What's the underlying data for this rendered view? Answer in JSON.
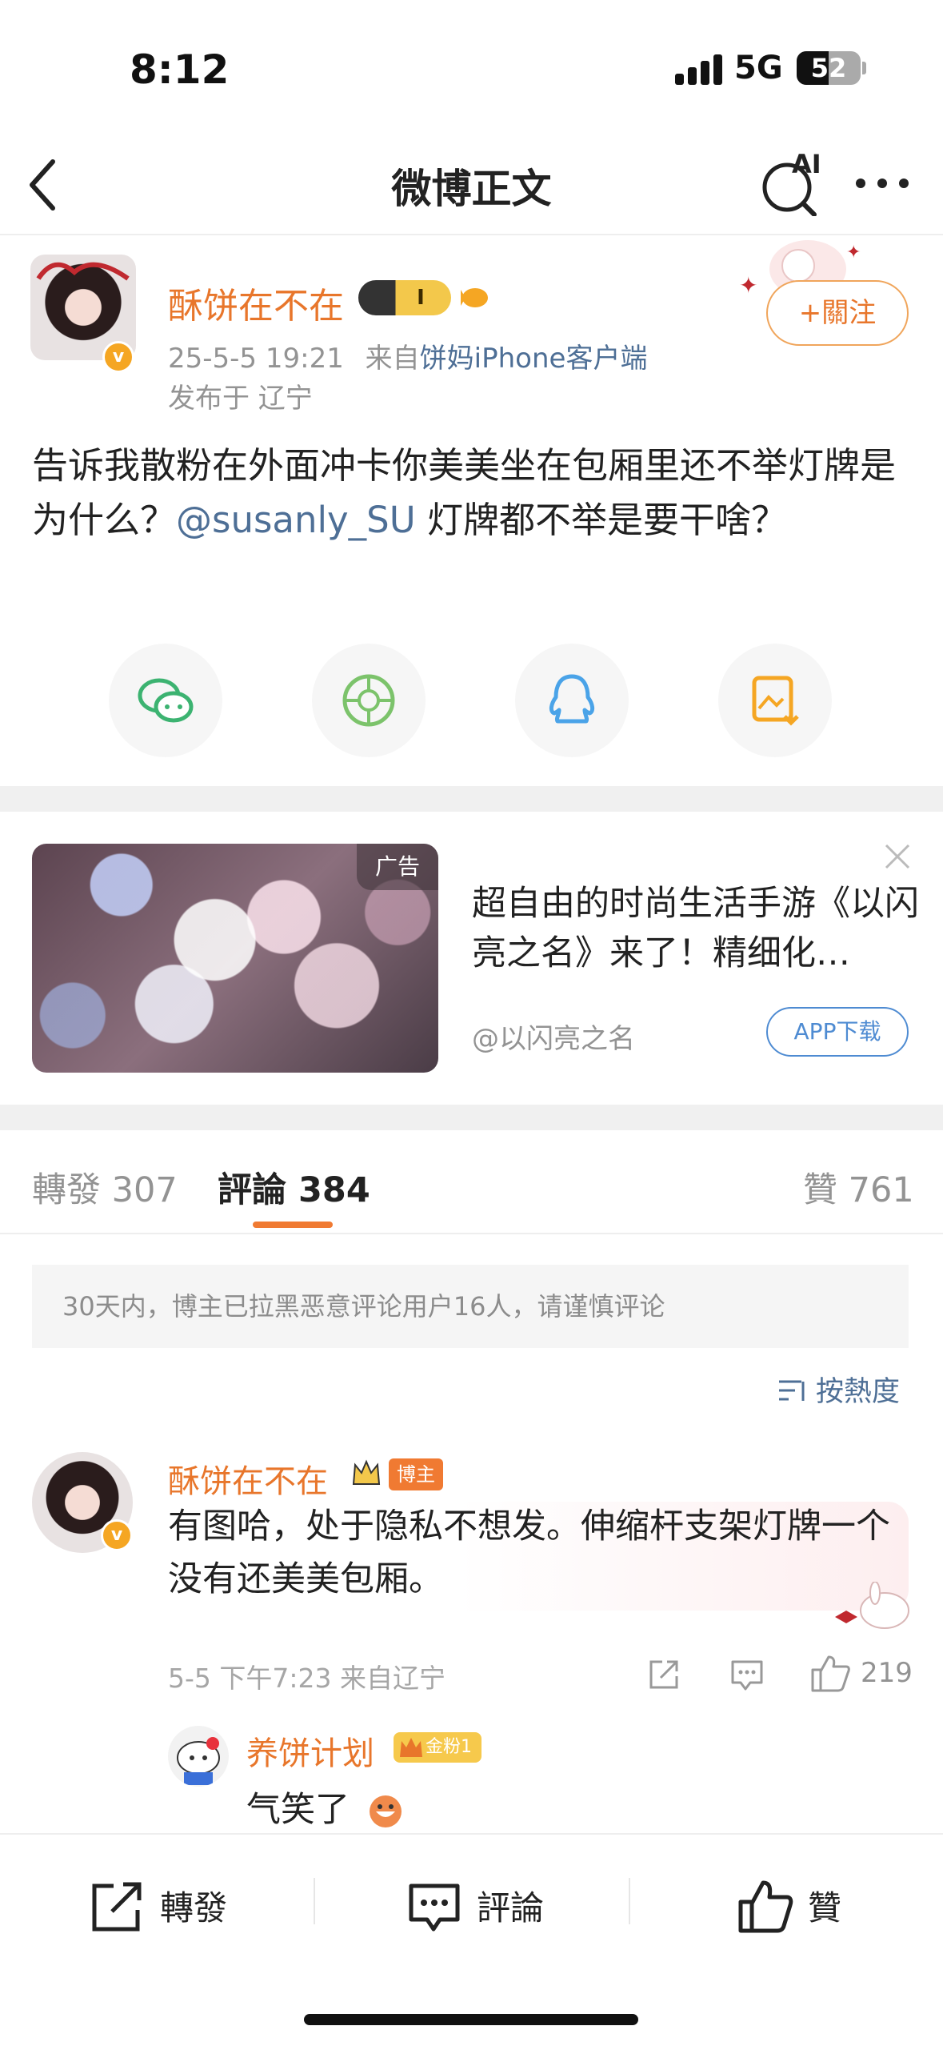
{
  "status_bar": {
    "time": "8:12",
    "network": "5G",
    "battery": "52"
  },
  "nav": {
    "title": "微博正文",
    "ai_label": "AI"
  },
  "post": {
    "username": "酥饼在不在",
    "member_badge": "I",
    "timestamp": "25-5-5 19:21",
    "source_prefix": "来自",
    "source": "饼妈iPhone客户端",
    "location": "发布于 辽宁",
    "follow_label": "+關注",
    "text_part1": "告诉我散粉在外面冲卡你美美坐在包厢里还不举灯牌是为什么？",
    "mention": "@susanly_SU",
    "text_part2": " 灯牌都不举是要干啥？"
  },
  "share_icons": [
    "wechat-icon",
    "moments-icon",
    "qq-icon",
    "save-image-icon"
  ],
  "ad": {
    "tag": "广告",
    "title": "超自由的时尚生活手游《以闪亮之名》来了！精细化…",
    "handle": "@以闪亮之名",
    "button": "APP下载"
  },
  "tabs": {
    "repost_label": "轉發",
    "repost_count": "307",
    "comment_label": "評論",
    "comment_count": "384",
    "like_label": "贊",
    "like_count": "761"
  },
  "notice": "30天内，博主已拉黑恶意评论用户16人，请谨慎评论",
  "sort_label": "按熱度",
  "comment": {
    "username": "酥饼在不在",
    "host_badge": "博主",
    "text": "有图哈，处于隐私不想发。伸缩杆支架灯牌一个没有还美美包厢。",
    "meta": "5-5 下午7:23 来自辽宁",
    "likes": "219"
  },
  "reply": {
    "username": "养饼计划",
    "fan_badge": "金粉1",
    "text": "气笑了"
  },
  "bottom_bar": {
    "repost": "轉發",
    "comment": "評論",
    "like": "贊"
  }
}
